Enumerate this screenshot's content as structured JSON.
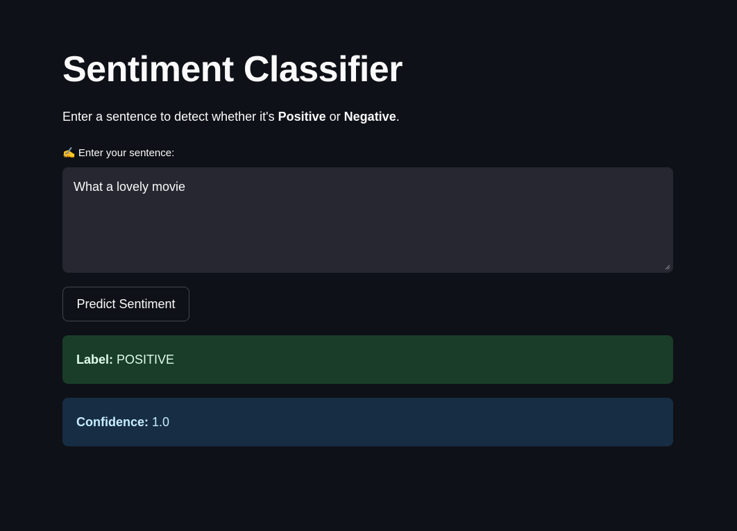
{
  "page": {
    "title": "Sentiment Classifier",
    "subtitle": {
      "prefix": "Enter a sentence to detect whether it's ",
      "positive": "Positive",
      "middle": " or ",
      "negative": "Negative",
      "suffix": "."
    }
  },
  "input": {
    "label_emoji": "✍️",
    "label": "Enter your sentence:",
    "value": "What a lovely movie"
  },
  "predict_button": {
    "label": "Predict Sentiment"
  },
  "result": {
    "label_key": "Label:",
    "label_value": "POSITIVE",
    "confidence_key": "Confidence:",
    "confidence_value": "1.0"
  },
  "colors": {
    "background": "#0e1117",
    "input_bg": "#262730",
    "success_bg": "#1a3d2a",
    "success_text": "#dffde9",
    "info_bg": "#172d43",
    "info_text": "#c7ebff"
  },
  "icons": {
    "input_label": "writing-hand-icon",
    "textarea_resize": "resize-handle-icon"
  }
}
